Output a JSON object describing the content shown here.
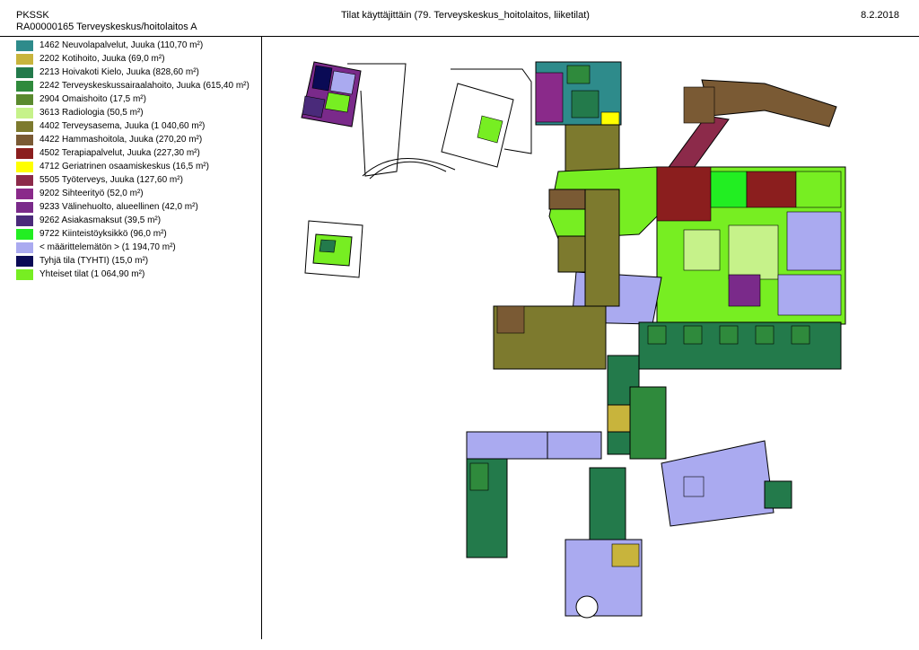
{
  "header": {
    "org": "PKSSK",
    "code": "RA00000165 Terveyskeskus/hoitolaitos A",
    "title": "Tilat käyttäjittäin  (79. Terveyskeskus_hoitolaitos, liiketilat)",
    "date": "8.2.2018"
  },
  "legend": [
    {
      "label": "1462 Neuvolapalvelut, Juuka (110,70 m²)",
      "color": "#2e8b8b"
    },
    {
      "label": "2202 Kotihoito, Juuka (69,0 m²)",
      "color": "#c8b43c"
    },
    {
      "label": "2213 Hoivakoti Kielo, Juuka (828,60 m²)",
      "color": "#237a4b"
    },
    {
      "label": "2242 Terveyskeskussairaalahoito, Juuka (615,40 m²)",
      "color": "#2f8a3c"
    },
    {
      "label": "2904 Omaishoito (17,5 m²)",
      "color": "#5a8a2e"
    },
    {
      "label": "3613 Radiologia (50,5 m²)",
      "color": "#c6f28a"
    },
    {
      "label": "4402 Terveysasema, Juuka (1 040,60 m²)",
      "color": "#7d7a2e"
    },
    {
      "label": "4422 Hammashoitola, Juuka (270,20 m²)",
      "color": "#7a5a34"
    },
    {
      "label": "4502 Terapiapalvelut, Juuka (227,30 m²)",
      "color": "#8b1e1e"
    },
    {
      "label": "4712 Geriatrinen osaamiskeskus (16,5 m²)",
      "color": "#ffff00"
    },
    {
      "label": "5505 Työterveys, Juuka (127,60 m²)",
      "color": "#8c2a4a"
    },
    {
      "label": "9202 Sihteerityö (52,0 m²)",
      "color": "#8a2a8a"
    },
    {
      "label": "9233 Välinehuolto, alueellinen (42,0 m²)",
      "color": "#7a2a8a"
    },
    {
      "label": "9262 Asiakasmaksut (39,5 m²)",
      "color": "#4a2a7a"
    },
    {
      "label": "9722 Kiinteistöyksikkö (96,0 m²)",
      "color": "#22ee22"
    },
    {
      "label": "< määrittelemätön > (1 194,70 m²)",
      "color": "#aaaaf0"
    },
    {
      "label": "Tyhjä tila (TYHTI) (15,0 m²)",
      "color": "#0a0a55"
    },
    {
      "label": "Yhteiset tilat (1 064,90 m²)",
      "color": "#77ee22"
    }
  ]
}
